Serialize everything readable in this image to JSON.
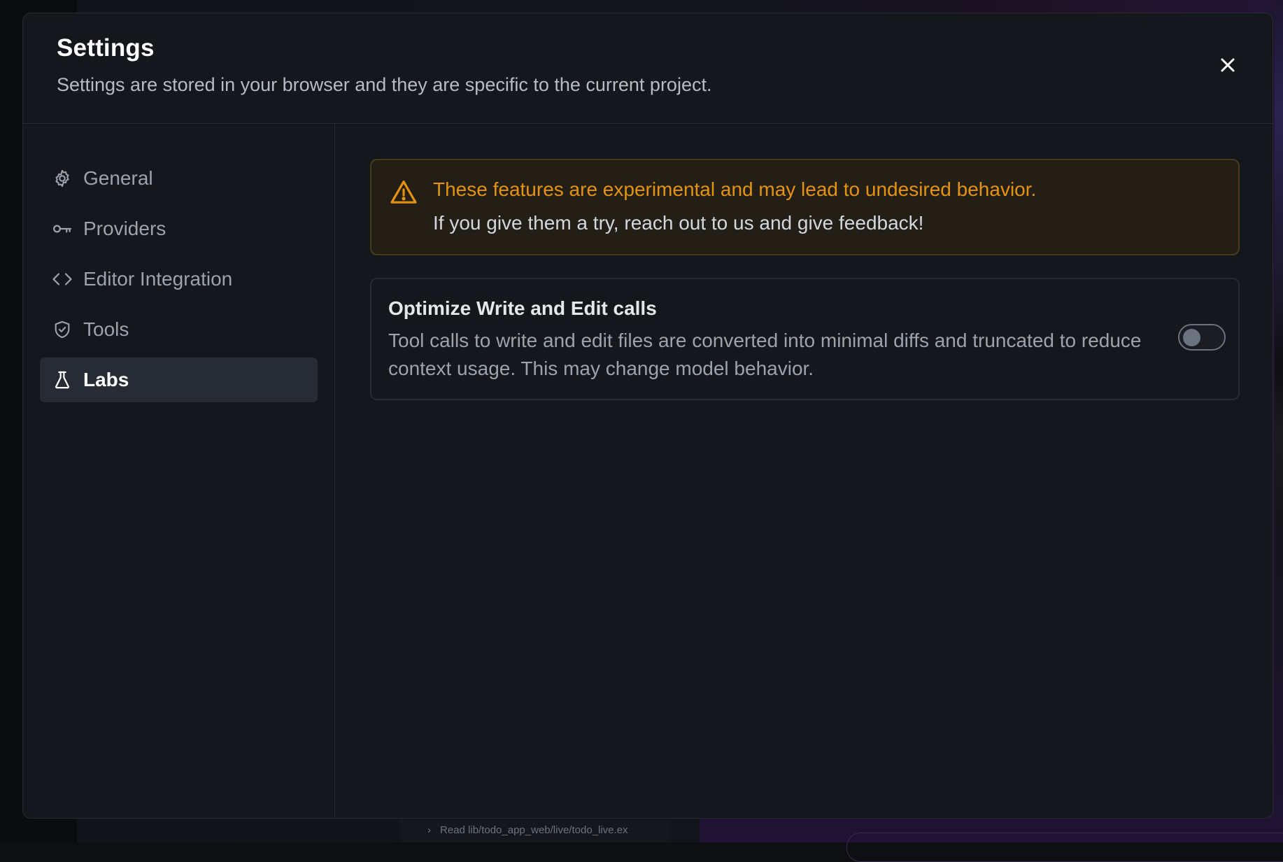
{
  "background": {
    "log_line": "Read lib/todo_app_web/live/todo_live.ex"
  },
  "modal": {
    "title": "Settings",
    "subtitle": "Settings are stored in your browser and they are specific to the current project."
  },
  "sidebar": {
    "items": [
      {
        "label": "General",
        "icon": "gear-icon",
        "active": false
      },
      {
        "label": "Providers",
        "icon": "key-icon",
        "active": false
      },
      {
        "label": "Editor Integration",
        "icon": "code-icon",
        "active": false
      },
      {
        "label": "Tools",
        "icon": "shield-check-icon",
        "active": false
      },
      {
        "label": "Labs",
        "icon": "flask-icon",
        "active": true
      }
    ]
  },
  "labs": {
    "warning_title": "These features are experimental and may lead to undesired behavior.",
    "warning_body": "If you give them a try, reach out to us and give feedback!",
    "settings": [
      {
        "title": "Optimize Write and Edit calls",
        "description": "Tool calls to write and edit files are converted into minimal diffs and truncated to reduce context usage. This may change model behavior.",
        "enabled": false
      }
    ]
  },
  "colors": {
    "warning_accent": "#e5930f",
    "active_nav_bg": "#272b33",
    "modal_bg": "#14171c"
  }
}
